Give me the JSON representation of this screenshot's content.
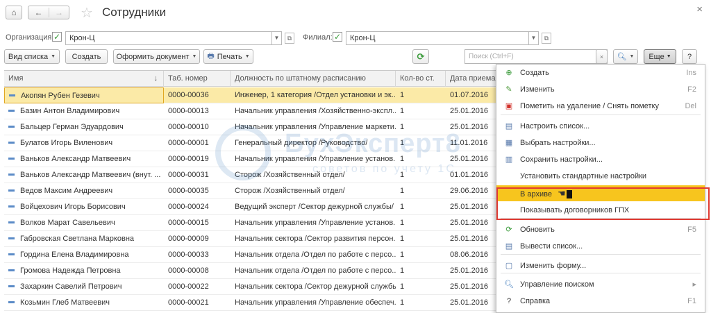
{
  "window": {
    "title": "Сотрудники",
    "home_icon": "home-icon",
    "back_icon": "arrow-left-icon",
    "forward_icon": "arrow-right-icon",
    "favorite_icon": "star-icon",
    "close_icon": "close-icon"
  },
  "filters": {
    "org_label": "Организация:",
    "org_value": "Крон-Ц",
    "branch_label": "Филиал:",
    "branch_value": "Крон-Ц"
  },
  "toolbar": {
    "view_list": "Вид списка",
    "create": "Создать",
    "make_document": "Оформить документ",
    "print": "Печать",
    "search_placeholder": "Поиск (Ctrl+F)",
    "more": "Еще",
    "help": "?"
  },
  "table": {
    "columns": [
      "Имя",
      "Таб. номер",
      "Должность по штатному расписанию",
      "Кол-во ст.",
      "Дата приема"
    ],
    "rows": [
      [
        "Акопян Рубен Гезевич",
        "0000-00036",
        "Инженер, 1 категория /Отдел установки и эк...",
        "1",
        "01.07.2016"
      ],
      [
        "Базин Антон Владимирович",
        "0000-00013",
        "Начальник управления /Хозяйственно-экспл...",
        "1",
        "25.01.2016"
      ],
      [
        "Бальцер Герман Эдуардович",
        "0000-00010",
        "Начальник управления /Управление маркети...",
        "1",
        "25.01.2016"
      ],
      [
        "Булатов Игорь Виленович",
        "0000-00001",
        "Генеральный директор /Руководство/",
        "1",
        "11.01.2016"
      ],
      [
        "Ваньков Александр Матвеевич",
        "0000-00019",
        "Начальник управления /Управление установ...",
        "1",
        "25.01.2016"
      ],
      [
        "Ваньков Александр Матвеевич (внут. ...",
        "0000-00031",
        "Сторож /Хозяйственный отдел/",
        "1",
        "01.01.2016"
      ],
      [
        "Ведов Максим Андреевич",
        "0000-00035",
        "Сторож /Хозяйственный отдел/",
        "1",
        "29.06.2016"
      ],
      [
        "Войцехович Игорь Борисович",
        "0000-00024",
        "Ведущий эксперт /Сектор дежурной службы/",
        "1",
        "25.01.2016"
      ],
      [
        "Волков Марат Савельевич",
        "0000-00015",
        "Начальник управления /Управление установ...",
        "1",
        "25.01.2016"
      ],
      [
        "Габровская Светлана Марковна",
        "0000-00009",
        "Начальник сектора /Сектор развития персон...",
        "1",
        "25.01.2016"
      ],
      [
        "Гордина Елена Владимировна",
        "0000-00033",
        "Начальник отдела /Отдел по работе с персо...",
        "1",
        "08.06.2016"
      ],
      [
        "Громова Надежда Петровна",
        "0000-00008",
        "Начальник отдела /Отдел по работе с персо...",
        "1",
        "25.01.2016"
      ],
      [
        "Захаркин Савелий Петрович",
        "0000-00022",
        "Начальник сектора /Сектор дежурной службы/",
        "1",
        "25.01.2016"
      ],
      [
        "Козьмин Глеб Матвеевич",
        "0000-00021",
        "Начальник управления /Управление обеспеч...",
        "1",
        "25.01.2016"
      ]
    ]
  },
  "menu": {
    "items": [
      {
        "label": "Создать",
        "shortcut": "Ins",
        "icon": "plus-icon",
        "color": "#3a9b3a"
      },
      {
        "label": "Изменить",
        "shortcut": "F2",
        "icon": "pencil-icon",
        "color": "#4f9a3c"
      },
      {
        "label": "Пометить на удаление / Снять пометку",
        "shortcut": "Del",
        "icon": "delete-mark-icon",
        "color": "#d2312b"
      },
      {
        "label": "Настроить список...",
        "shortcut": "",
        "icon": "list-settings-icon",
        "color": "#5577aa"
      },
      {
        "label": "Выбрать настройки...",
        "shortcut": "",
        "icon": "load-settings-icon",
        "color": "#5577aa"
      },
      {
        "label": "Сохранить настройки...",
        "shortcut": "",
        "icon": "save-settings-icon",
        "color": "#5577aa"
      },
      {
        "label": "Установить стандартные настройки",
        "shortcut": "",
        "icon": "",
        "color": "#5577aa"
      },
      {
        "label": "В архиве",
        "shortcut": "",
        "icon": "",
        "color": "#333"
      },
      {
        "label": "Показывать договорников ГПХ",
        "shortcut": "",
        "icon": "",
        "color": "#333"
      },
      {
        "label": "Обновить",
        "shortcut": "F5",
        "icon": "refresh-icon",
        "color": "#3a9b3a"
      },
      {
        "label": "Вывести список...",
        "shortcut": "",
        "icon": "export-list-icon",
        "color": "#5577aa"
      },
      {
        "label": "Изменить форму...",
        "shortcut": "",
        "icon": "form-icon",
        "color": "#5577aa"
      },
      {
        "label": "Управление поиском",
        "shortcut": "▸",
        "icon": "search-icon",
        "color": "#2c6fb7"
      },
      {
        "label": "Справка",
        "shortcut": "F1",
        "icon": "help-icon",
        "color": "#333"
      }
    ]
  },
  "watermark": {
    "brand": "БухЭксперт8",
    "subtitle": "советов по учету 1С"
  }
}
